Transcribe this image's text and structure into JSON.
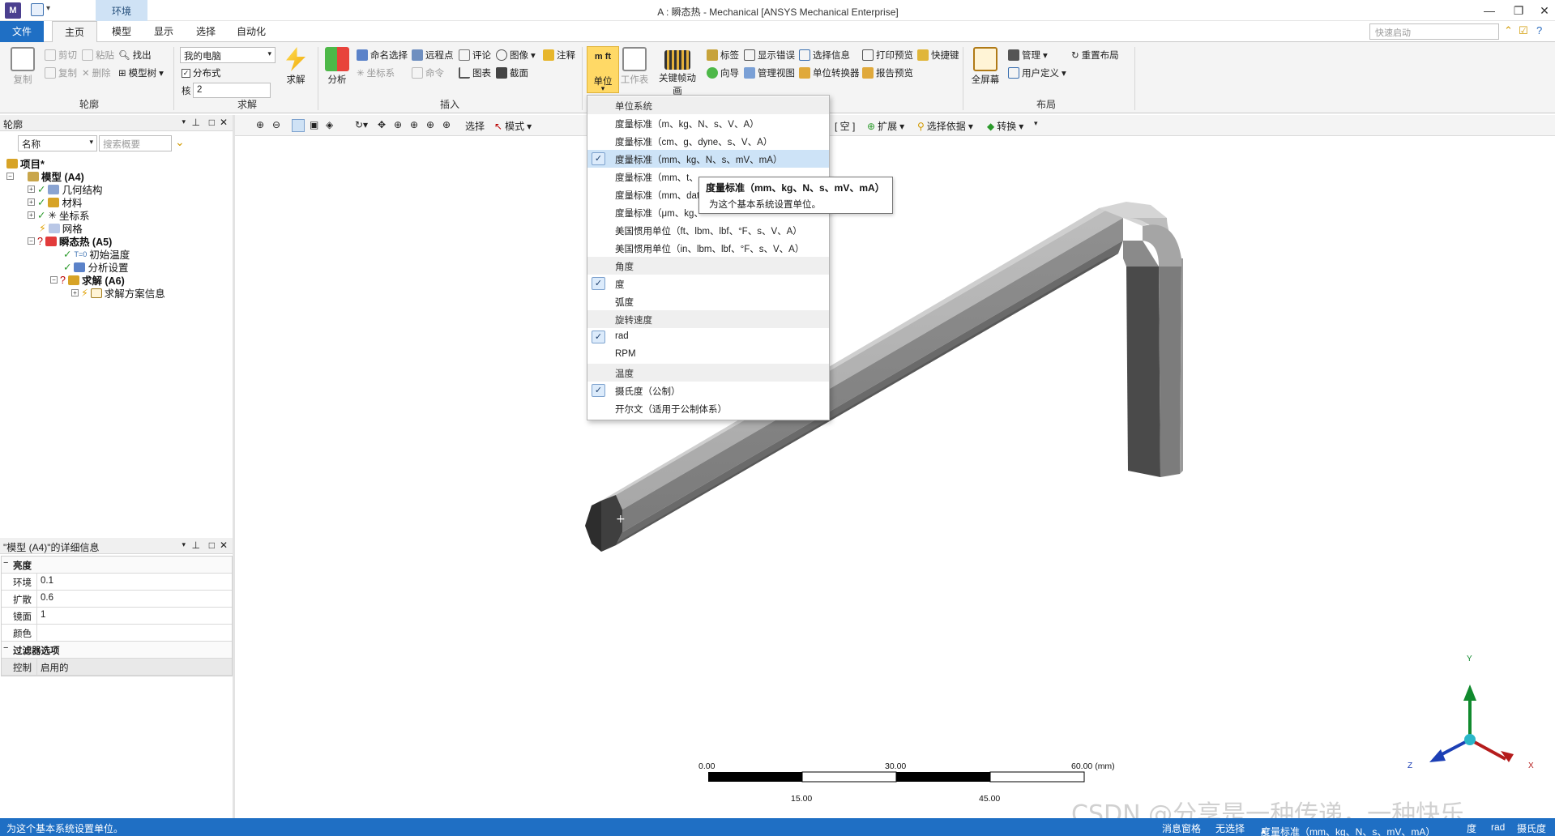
{
  "app": {
    "logo": "M",
    "context_tab": "环境",
    "window_title": "A : 瞬态热 - Mechanical [ANSYS Mechanical Enterprise]",
    "quick_launch_placeholder": "快速启动"
  },
  "tabs": [
    "文件",
    "主页",
    "模型",
    "显示",
    "选择",
    "自动化"
  ],
  "ribbon": {
    "outline": {
      "label": "轮廓",
      "copy": "复制",
      "cut": "剪切",
      "paste": "粘贴",
      "find": "找出",
      "duplicate": "复制",
      "delete": "删除",
      "tree": "模型树"
    },
    "solve": {
      "label": "求解",
      "machine": "我的电脑",
      "distributed": "分布式",
      "cores_label": "核",
      "cores": "2",
      "solve_btn": "求解"
    },
    "insert": {
      "label": "插入",
      "analysis": "分析",
      "named_sel": "命名选择",
      "coord": "坐标系",
      "remote_pt": "远程点",
      "commands": "命令",
      "comment": "评论",
      "chart": "图表",
      "image": "图像",
      "section": "截面",
      "annotation": "注释"
    },
    "tools": {
      "units": "单位",
      "worksheet": "工作表",
      "keyframe": "关键帧动画",
      "tags": "标签",
      "wizard": "向导",
      "show_errors": "显示错误",
      "manage_views": "管理视图",
      "selection_info": "选择信息",
      "unit_converter": "单位转换器",
      "print_preview": "打印预览",
      "report_preview": "报告预览",
      "shortcuts": "快捷键"
    },
    "layout": {
      "label": "布局",
      "fullscreen": "全屏幕",
      "manage": "管理",
      "user_defined": "用户定义",
      "reset_layout": "重置布局"
    }
  },
  "outline_panel": {
    "title": "轮廓",
    "name_filter": "名称",
    "search_placeholder": "搜索概要",
    "tree": [
      {
        "label": "项目*",
        "bold": true
      },
      {
        "label": "模型 (A4)",
        "bold": true
      },
      {
        "label": "几何结构",
        "bold": false
      },
      {
        "label": "材料",
        "bold": false
      },
      {
        "label": "坐标系",
        "bold": false
      },
      {
        "label": "网格",
        "bold": false
      },
      {
        "label": "瞬态热 (A5)",
        "bold": true
      },
      {
        "label": "初始温度",
        "bold": false
      },
      {
        "label": "分析设置",
        "bold": false
      },
      {
        "label": "求解 (A6)",
        "bold": true
      },
      {
        "label": "求解方案信息",
        "bold": false
      }
    ]
  },
  "details_panel": {
    "title": "\"模型 (A4)\"的详细信息",
    "sections": [
      {
        "name": "亮度",
        "rows": [
          {
            "k": "环境",
            "v": "0.1"
          },
          {
            "k": "扩散",
            "v": "0.6"
          },
          {
            "k": "镜面",
            "v": "1"
          },
          {
            "k": "颜色",
            "v": ""
          }
        ]
      },
      {
        "name": "过滤器选项",
        "rows": [
          {
            "k": "控制",
            "v": "启用的"
          }
        ]
      }
    ]
  },
  "graphics_toolbar": {
    "select": "选择",
    "mode": "模式",
    "empty": "[ 空 ]",
    "expand": "扩展",
    "select_by": "选择依据",
    "convert": "转换"
  },
  "units_menu": {
    "items": [
      {
        "label": "单位系统",
        "type": "header",
        "checked": false
      },
      {
        "label": "度量标准（m、kg、N、s、V、A）",
        "type": "item",
        "checked": false
      },
      {
        "label": "度量标准（cm、g、dyne、s、V、A）",
        "type": "item",
        "checked": false
      },
      {
        "label": "度量标准（mm、kg、N、s、mV、mA）",
        "type": "item",
        "checked": true
      },
      {
        "label": "度量标准（mm、t、",
        "type": "item",
        "checked": false
      },
      {
        "label": "度量标准（mm、dat",
        "type": "item",
        "checked": false
      },
      {
        "label": "度量标准（μm、kg、",
        "type": "item",
        "checked": false
      },
      {
        "label": "美国惯用单位（ft、lbm、lbf、°F、s、V、A）",
        "type": "item",
        "checked": false
      },
      {
        "label": "美国惯用单位（in、lbm、lbf、°F、s、V、A）",
        "type": "item",
        "checked": false
      },
      {
        "label": "角度",
        "type": "header",
        "checked": false
      },
      {
        "label": "度",
        "type": "item",
        "checked": true
      },
      {
        "label": "弧度",
        "type": "item",
        "checked": false
      },
      {
        "label": "旋转速度",
        "type": "header",
        "checked": false
      },
      {
        "label": "rad",
        "type": "item",
        "checked": true
      },
      {
        "label": "RPM",
        "type": "item",
        "checked": false
      },
      {
        "label": "温度",
        "type": "header",
        "checked": false
      },
      {
        "label": "摄氏度（公制）",
        "type": "item",
        "checked": true
      },
      {
        "label": "开尔文（适用于公制体系）",
        "type": "item",
        "checked": false
      }
    ]
  },
  "tooltip": {
    "title": "度量标准（mm、kg、N、s、mV、mA）",
    "body": "为这个基本系统设置单位。"
  },
  "scale": {
    "t0": "0.00",
    "t30": "30.00",
    "t60": "60.00 (mm)",
    "b15": "15.00",
    "b45": "45.00"
  },
  "triad": {
    "x": "X",
    "y": "Y",
    "z": "Z"
  },
  "status": {
    "message": "为这个基本系统设置单位。",
    "msg_pane": "消息窗格",
    "selection": "无选择",
    "unit_system": "度量标准（mm、kg、N、s、mV、mA）",
    "angle": "度",
    "rot": "rad",
    "temp": "摄氏度"
  },
  "watermark": "CSDN @分享是一种传递，一种快乐",
  "colors": {
    "accent": "#1f6fc4",
    "highlight": "#ffd966",
    "menu_hover": "#cde3f7",
    "pipe": "#9c9c9c"
  }
}
